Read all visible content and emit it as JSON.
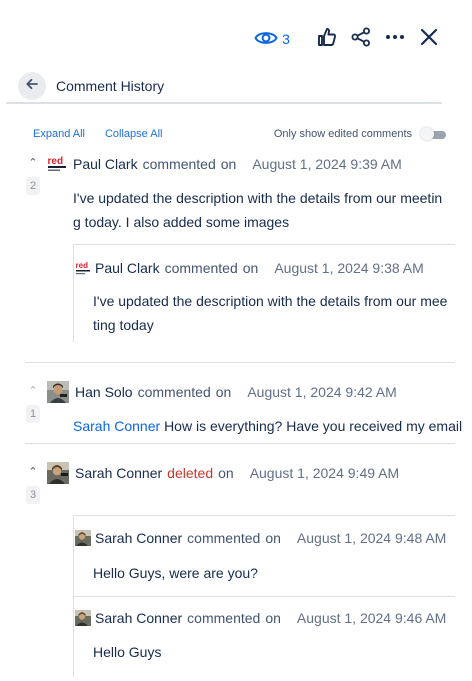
{
  "toolbar": {
    "watch_count": "3",
    "icons": [
      "eye-icon",
      "thumbs-up-icon",
      "share-icon",
      "more-icon",
      "close-icon"
    ]
  },
  "header": {
    "title": "Comment History"
  },
  "controls": {
    "expand_all": "Expand All",
    "collapse_all": "Collapse All",
    "toggle_label": "Only show edited comments",
    "toggle_on": false
  },
  "colors": {
    "accent": "#0c66e4",
    "deleted": "#c9372c",
    "divider": "#dcdfe4"
  },
  "threads": [
    {
      "count": "2",
      "author": "Paul Clark",
      "action": "commented",
      "on": "on",
      "date": "August 1, 2024 9:39 AM",
      "body_line1": "I've updated the description with the details from our meetin",
      "body_line2": "g today. I also added some images",
      "history": [
        {
          "author": "Paul Clark",
          "action": "commented",
          "on": "on",
          "date": "August 1, 2024 9:38 AM",
          "body_line1": "I've updated the description with the details from our mee",
          "body_line2": "ting today"
        }
      ]
    },
    {
      "count": "1",
      "author": "Han Solo",
      "action": "commented",
      "on": "on",
      "date": "August 1, 2024 9:42 AM",
      "mention": "Sarah Conner",
      "body": "How is everything? Have you received my email"
    },
    {
      "count": "3",
      "author": "Sarah Conner",
      "action": "deleted",
      "on": "on",
      "date": "August 1, 2024 9:49 AM",
      "history": [
        {
          "author": "Sarah Conner",
          "action": "commented",
          "on": "on",
          "date": "August 1, 2024 9:48 AM",
          "body": "Hello Guys, were are you?"
        },
        {
          "author": "Sarah Conner",
          "action": "commented",
          "on": "on",
          "date": "August 1, 2024 9:46 AM",
          "body": "Hello Guys"
        }
      ]
    }
  ]
}
